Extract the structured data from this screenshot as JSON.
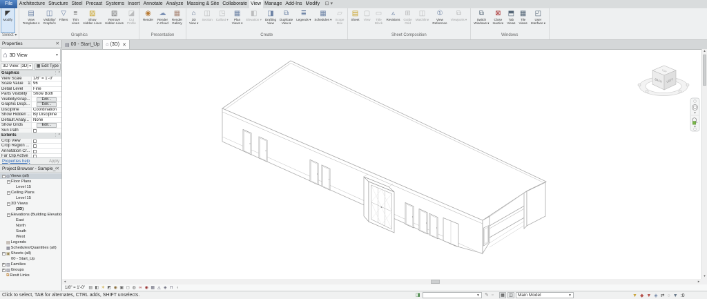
{
  "tabs": {
    "items": [
      {
        "label": "File",
        "file": true
      },
      {
        "label": "Architecture"
      },
      {
        "label": "Structure"
      },
      {
        "label": "Steel"
      },
      {
        "label": "Precast"
      },
      {
        "label": "Systems"
      },
      {
        "label": "Insert"
      },
      {
        "label": "Annotate"
      },
      {
        "label": "Analyze"
      },
      {
        "label": "Massing & Site"
      },
      {
        "label": "Collaborate"
      },
      {
        "label": "View",
        "active": true
      },
      {
        "label": "Manage"
      },
      {
        "label": "Add-Ins"
      },
      {
        "label": "Modify"
      }
    ]
  },
  "ribbon": {
    "panels": [
      {
        "label": "Select ▾",
        "buttons": [
          {
            "label": "Modify",
            "icon": "modify-cursor",
            "selected": true
          }
        ]
      },
      {
        "label": "Graphics",
        "buttons": [
          {
            "label": "View\nTemplates",
            "icon": "view-templates",
            "arrow": true
          },
          {
            "label": "Visibility/\nGraphics",
            "icon": "visibility-graphics"
          },
          {
            "label": "Filters",
            "icon": "filters"
          },
          {
            "label": "Thin\nLines",
            "icon": "thin-lines"
          },
          {
            "label": "Show\nHidden Lines",
            "icon": "show-hidden-lines"
          },
          {
            "label": "Remove\nHidden Lines",
            "icon": "remove-hidden-lines"
          },
          {
            "label": "Cut\nProfile",
            "icon": "cut-profile",
            "disabled": true
          }
        ]
      },
      {
        "label": "Presentation",
        "buttons": [
          {
            "label": "Render",
            "icon": "render"
          },
          {
            "label": "Render\nin Cloud",
            "icon": "render-in-cloud"
          },
          {
            "label": "Render\nGallery",
            "icon": "render-gallery"
          }
        ]
      },
      {
        "label": "Create",
        "buttons": [
          {
            "label": "3D\nView",
            "icon": "default-3d-view",
            "arrow": true
          },
          {
            "label": "Section",
            "icon": "section",
            "disabled": true
          },
          {
            "label": "Callout",
            "icon": "callout",
            "disabled": true,
            "arrow": true
          },
          {
            "label": "Plan\nViews",
            "icon": "plan-views",
            "arrow": true
          },
          {
            "label": "Elevation",
            "icon": "elevation",
            "disabled": true,
            "arrow": true
          },
          {
            "label": "Drafting\nView",
            "icon": "drafting-view"
          },
          {
            "label": "Duplicate\nView",
            "icon": "duplicate-view",
            "arrow": true
          },
          {
            "label": "Legends",
            "icon": "legends",
            "arrow": true
          },
          {
            "label": "Schedules",
            "icon": "schedules",
            "arrow": true
          },
          {
            "label": "Scope\nBox",
            "icon": "scope-box",
            "disabled": true
          }
        ]
      },
      {
        "label": "Sheet Composition",
        "buttons": [
          {
            "label": "Sheet",
            "icon": "sheet"
          },
          {
            "label": "View",
            "icon": "view",
            "disabled": true
          },
          {
            "label": "Title\nBlock",
            "icon": "title-block",
            "disabled": true
          },
          {
            "label": "Revisions",
            "icon": "revisions"
          },
          {
            "label": "Guide\nGrid",
            "icon": "guide-grid",
            "disabled": true
          },
          {
            "label": "Matchline",
            "icon": "matchline",
            "disabled": true
          },
          {
            "label": "View\nReference",
            "icon": "view-reference"
          },
          {
            "label": "Viewports",
            "icon": "viewports",
            "disabled": true,
            "arrow": true
          }
        ]
      },
      {
        "label": "Windows",
        "buttons": [
          {
            "label": "Switch\nWindows",
            "icon": "switch-windows",
            "arrow": true
          },
          {
            "label": "Close\nInactive",
            "icon": "close-inactive"
          },
          {
            "label": "Tab\nViews",
            "icon": "tab-views"
          },
          {
            "label": "Tile\nViews",
            "icon": "tile-views"
          },
          {
            "label": "User\nInterface",
            "icon": "user-interface",
            "arrow": true
          }
        ]
      }
    ]
  },
  "properties": {
    "title": "Properties",
    "close": "✕",
    "type_label": "3D View",
    "instance_label": "3D View: (3D)",
    "edit_type": "Edit Type",
    "sections": [
      {
        "header": "Graphics",
        "rows": [
          {
            "label": "View Scale",
            "value": "1/8\" = 1'-0\""
          },
          {
            "label": "Scale Value    1:",
            "value": "96"
          },
          {
            "label": "Detail Level",
            "value": "Fine"
          },
          {
            "label": "Parts Visibility",
            "value": "Show Both"
          },
          {
            "label": "Visibility/Grap...",
            "value": "Edit...",
            "type": "button"
          },
          {
            "label": "Graphic Displ...",
            "value": "Edit...",
            "type": "button"
          },
          {
            "label": "Discipline",
            "value": "Coordination"
          },
          {
            "label": "Show Hidden ...",
            "value": "By Discipline"
          },
          {
            "label": "Default Analy...",
            "value": "None"
          },
          {
            "label": "Show Grids",
            "value": "Edit...",
            "type": "button"
          },
          {
            "label": "Sun Path",
            "value": "",
            "type": "checkbox"
          }
        ]
      },
      {
        "header": "Extents",
        "rows": [
          {
            "label": "Crop View",
            "value": "",
            "type": "checkbox"
          },
          {
            "label": "Crop Region ...",
            "value": "",
            "type": "checkbox"
          },
          {
            "label": "Annotation Cr...",
            "value": "",
            "type": "checkbox"
          },
          {
            "label": "Far Clip Active",
            "value": "",
            "type": "checkbox"
          }
        ]
      }
    ],
    "help": "Properties help",
    "apply": "Apply"
  },
  "browser": {
    "title": "Project Browser - Sample_Office Sp...",
    "close": "✕",
    "items": [
      {
        "label": "Views (all)",
        "indent": 0,
        "exp": "minus",
        "icon": "views",
        "selected": true
      },
      {
        "label": "Floor Plans",
        "indent": 1,
        "exp": "minus"
      },
      {
        "label": "Level 15",
        "indent": 2
      },
      {
        "label": "Ceiling Plans",
        "indent": 1,
        "exp": "minus"
      },
      {
        "label": "Level 15",
        "indent": 2
      },
      {
        "label": "3D Views",
        "indent": 1,
        "exp": "minus"
      },
      {
        "label": "(3D)",
        "indent": 2,
        "bold": true
      },
      {
        "label": "Elevations (Building Elevation)",
        "indent": 1,
        "exp": "minus"
      },
      {
        "label": "East",
        "indent": 2
      },
      {
        "label": "North",
        "indent": 2
      },
      {
        "label": "South",
        "indent": 2
      },
      {
        "label": "West",
        "indent": 2
      },
      {
        "label": "Legends",
        "indent": 0,
        "icon": "legends-tree"
      },
      {
        "label": "Schedules/Quantities (all)",
        "indent": 0,
        "icon": "schedules-tree"
      },
      {
        "label": "Sheets (all)",
        "indent": 0,
        "exp": "minus",
        "icon": "sheets-tree"
      },
      {
        "label": "00 - Start_Up",
        "indent": 1
      },
      {
        "label": "Families",
        "indent": 0,
        "exp": "plus",
        "icon": "families-tree"
      },
      {
        "label": "Groups",
        "indent": 0,
        "exp": "plus",
        "icon": "groups-tree"
      },
      {
        "label": "Revit Links",
        "indent": 0,
        "icon": "revit-links-tree"
      }
    ]
  },
  "view_tabs": [
    {
      "label": "00 - Start_Up",
      "icon": "sheet-view"
    },
    {
      "label": "(3D)",
      "icon": "three-d-view",
      "active": true,
      "closable": true
    }
  ],
  "viewbar": {
    "scale": "1/8\" = 1'-0\"",
    "icons": [
      "detail-level",
      "visual-style",
      "sun-path",
      "shadows",
      "rendering-dialog",
      "crop-view",
      "crop-region",
      "locked-view",
      "temporary-hide-isolate",
      "reveal-hidden-elements",
      "temporary-view-properties",
      "analytical-model",
      "displacement-sets",
      "reveal-constraints",
      "collapse"
    ]
  },
  "viewcube": {
    "top": "TOP",
    "left_face": "BACK",
    "right_face": "LEFT"
  },
  "statusbar": {
    "hint": "Click to select, TAB for alternates, CTRL adds, SHIFT unselects.",
    "active_workset": "",
    "design_option": "Main Model",
    "filter_count": "0"
  }
}
